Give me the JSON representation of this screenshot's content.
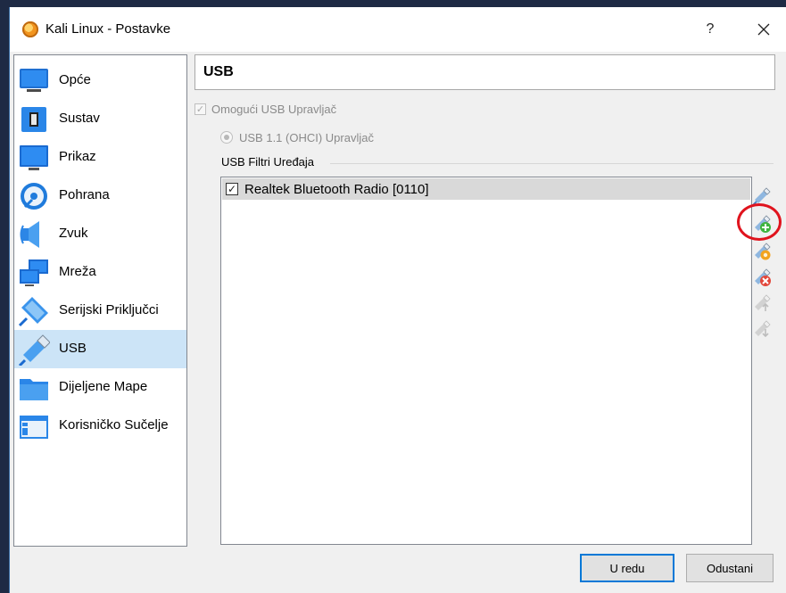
{
  "window": {
    "title": "Kali Linux - Postavke",
    "help_label": "?",
    "close_label": "✕"
  },
  "sidebar": {
    "items": [
      {
        "label": "Opće",
        "icon": "general-monitor-icon"
      },
      {
        "label": "Sustav",
        "icon": "chip-icon"
      },
      {
        "label": "Prikaz",
        "icon": "display-icon"
      },
      {
        "label": "Pohrana",
        "icon": "storage-disk-icon"
      },
      {
        "label": "Zvuk",
        "icon": "speaker-icon"
      },
      {
        "label": "Mreža",
        "icon": "network-icon"
      },
      {
        "label": "Serijski Priključci",
        "icon": "serial-port-icon"
      },
      {
        "label": "USB",
        "icon": "usb-icon"
      },
      {
        "label": "Dijeljene Mape",
        "icon": "shared-folder-icon"
      },
      {
        "label": "Korisničko Sučelje",
        "icon": "user-interface-icon"
      }
    ],
    "selected": "USB"
  },
  "main": {
    "title": "USB",
    "enable_usb_label": "Omogući USB Upravljač",
    "enable_usb_checked": true,
    "usb_controller_label": "USB 1.1 (OHCI) Upravljač",
    "filters_group_label": "USB Filtri Uređaja",
    "filters": [
      {
        "label": "Realtek Bluetooth Radio [0110]",
        "checked": true
      }
    ],
    "tools": [
      {
        "name": "add-empty-filter-icon",
        "enabled": true
      },
      {
        "name": "add-filter-from-device-icon",
        "enabled": true,
        "highlighted": true
      },
      {
        "name": "edit-filter-icon",
        "enabled": true
      },
      {
        "name": "remove-filter-icon",
        "enabled": true
      },
      {
        "name": "move-filter-up-icon",
        "enabled": false
      },
      {
        "name": "move-filter-down-icon",
        "enabled": false
      }
    ]
  },
  "buttons": {
    "ok": "U redu",
    "cancel": "Odustani"
  },
  "colors": {
    "selection": "#cce4f7",
    "accent": "#0078d7",
    "highlight_ring": "#e0141e"
  }
}
